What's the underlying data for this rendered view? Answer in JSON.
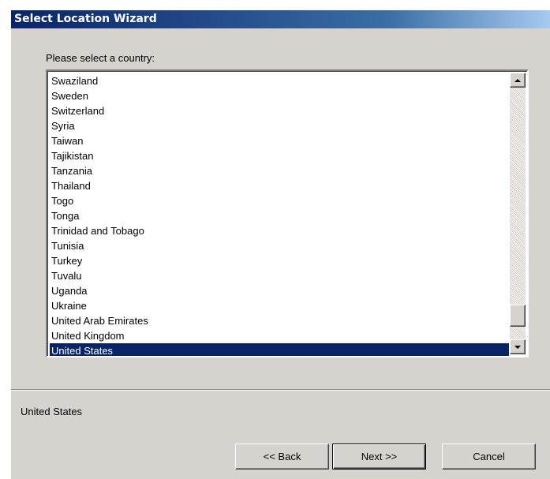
{
  "window": {
    "title": "Select Location Wizard"
  },
  "main": {
    "prompt": "Please select a country:",
    "countries": [
      "Swaziland",
      "Sweden",
      "Switzerland",
      "Syria",
      "Taiwan",
      "Tajikistan",
      "Tanzania",
      "Thailand",
      "Togo",
      "Tonga",
      "Trinidad and Tobago",
      "Tunisia",
      "Turkey",
      "Tuvalu",
      "Uganda",
      "Ukraine",
      "United Arab Emirates",
      "United Kingdom",
      "United States"
    ],
    "selected_country": "United States",
    "selection_text": "United States"
  },
  "buttons": {
    "back_label": "<< Back",
    "next_label": "Next >>",
    "cancel_label": "Cancel"
  },
  "icons": {
    "scroll_up": "triangle-up-icon",
    "scroll_down": "triangle-down-icon"
  },
  "colors": {
    "title_bar": "#0a246a",
    "selection_highlight": "#0a246a",
    "dialog_background": "#d6d3ce"
  }
}
